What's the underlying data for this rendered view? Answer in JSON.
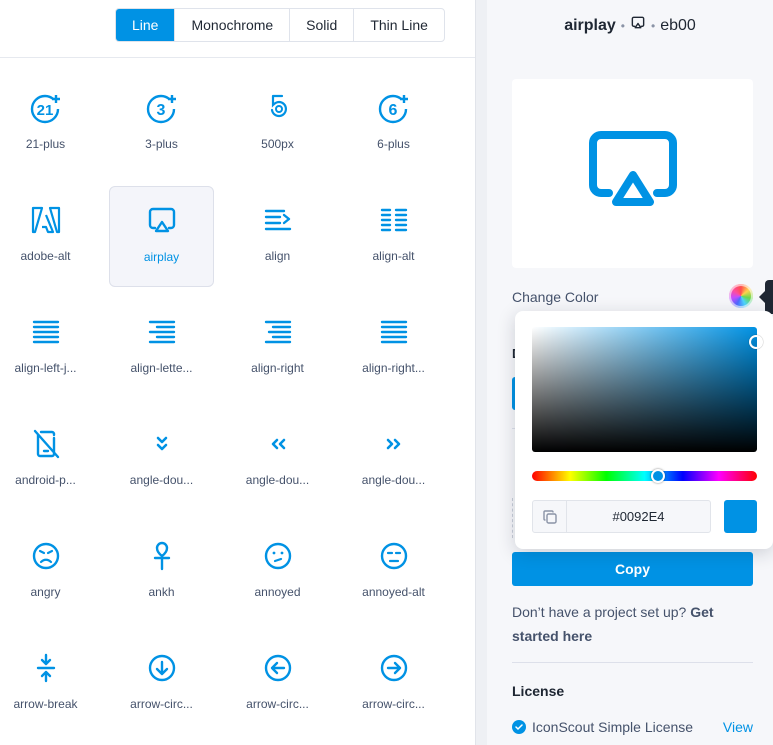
{
  "style_tabs": [
    {
      "label": "Line",
      "active": true
    },
    {
      "label": "Monochrome",
      "active": false
    },
    {
      "label": "Solid",
      "active": false
    },
    {
      "label": "Thin Line",
      "active": false
    }
  ],
  "icons": [
    {
      "label": "21-plus",
      "icon": "21-plus-icon"
    },
    {
      "label": "3-plus",
      "icon": "3-plus-icon"
    },
    {
      "label": "500px",
      "icon": "500px-icon"
    },
    {
      "label": "6-plus",
      "icon": "6-plus-icon"
    },
    {
      "label": "adobe-alt",
      "icon": "adobe-alt-icon"
    },
    {
      "label": "airplay",
      "icon": "airplay-icon",
      "selected": true
    },
    {
      "label": "align",
      "icon": "align-icon"
    },
    {
      "label": "align-alt",
      "icon": "align-alt-icon"
    },
    {
      "label": "align-left-j...",
      "icon": "align-left-justify-icon"
    },
    {
      "label": "align-lette...",
      "icon": "align-letter-rtl-icon"
    },
    {
      "label": "align-right",
      "icon": "align-right-icon"
    },
    {
      "label": "align-right...",
      "icon": "align-right-justify-icon"
    },
    {
      "label": "android-p...",
      "icon": "android-phone-slash-icon"
    },
    {
      "label": "angle-dou...",
      "icon": "angle-double-down-icon"
    },
    {
      "label": "angle-dou...",
      "icon": "angle-double-left-icon"
    },
    {
      "label": "angle-dou...",
      "icon": "angle-double-right-icon"
    },
    {
      "label": "angry",
      "icon": "angry-icon"
    },
    {
      "label": "ankh",
      "icon": "ankh-icon"
    },
    {
      "label": "annoyed",
      "icon": "annoyed-icon"
    },
    {
      "label": "annoyed-alt",
      "icon": "annoyed-alt-icon"
    },
    {
      "label": "arrow-break",
      "icon": "arrow-break-icon"
    },
    {
      "label": "arrow-circ...",
      "icon": "arrow-circle-down-icon"
    },
    {
      "label": "arrow-circ...",
      "icon": "arrow-circle-left-icon"
    },
    {
      "label": "arrow-circ...",
      "icon": "arrow-circle-right-icon"
    }
  ],
  "detail": {
    "name": "airplay",
    "code": "eb00",
    "change_color_label": "Change Color",
    "bg_heading_letter": "D",
    "copy_label": "Copy",
    "project_prompt": "Don’t have a project set up?",
    "project_link": "Get started here",
    "license_heading": "License",
    "license_name": "IconScout Simple License",
    "license_view": "View"
  },
  "color_picker": {
    "hex_value": "#0092E4",
    "hue_level": 0.56
  },
  "colors": {
    "accent": "#0092e4",
    "text": "#1f2733",
    "muted": "#45526b"
  }
}
